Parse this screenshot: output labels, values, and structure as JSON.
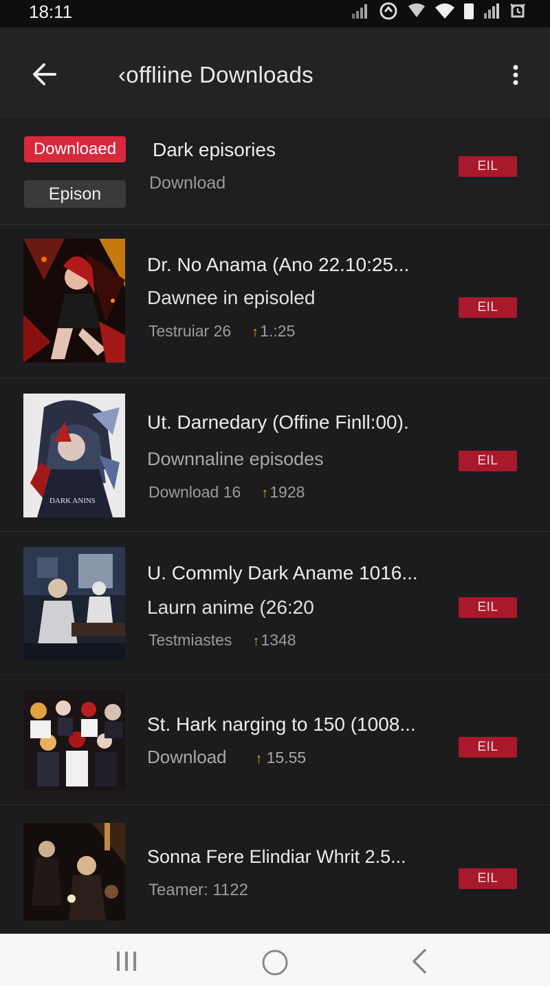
{
  "status_bar": {
    "time": "18:11"
  },
  "app_bar": {
    "title": "‹offliine Downloads"
  },
  "summary": {
    "badge_downloaded": "Downloaed",
    "badge_episode": "Epison",
    "title": "Dark episories",
    "subtitle": "Download",
    "action_label": "EIL"
  },
  "items": [
    {
      "title": "Dr. No Anama (Ano 22.10:25...",
      "subtitle": "Dawnee in episoled",
      "meta_left": "Testruiar 26",
      "meta_right": "1.:25",
      "action_label": "EIL"
    },
    {
      "title": "Ut. Darnedary (Offine Finll:00).",
      "subtitle": "Downnaline episodes",
      "meta_left": "Download 16",
      "meta_right": "1928",
      "thumb_caption": "DARK ANINS",
      "action_label": "EIL"
    },
    {
      "title": "U. Commly Dark Aname 1016...",
      "subtitle": "Laurn anime (26:20",
      "meta_left": "Testmiastes",
      "meta_right": "1348",
      "action_label": "EIL"
    },
    {
      "title": "St. Hark narging to 150  (1008...",
      "subtitle": "Download",
      "meta_right": "15.55",
      "action_label": "EIL"
    },
    {
      "title": "Sonna Fere Elindiar Whrit 2.5...",
      "meta_left": "Teamer: 1122",
      "action_label": "EIL"
    }
  ],
  "colors": {
    "accent_red": "#d8283c",
    "button_red": "#a8192b",
    "background": "#1c1c1e",
    "meta_arrow": "#c7a512"
  },
  "icons": {
    "back": "arrow-left-icon",
    "more": "more-vertical-icon",
    "nav_recents": "recents-icon",
    "nav_home": "home-icon",
    "nav_back": "nav-back-icon"
  }
}
